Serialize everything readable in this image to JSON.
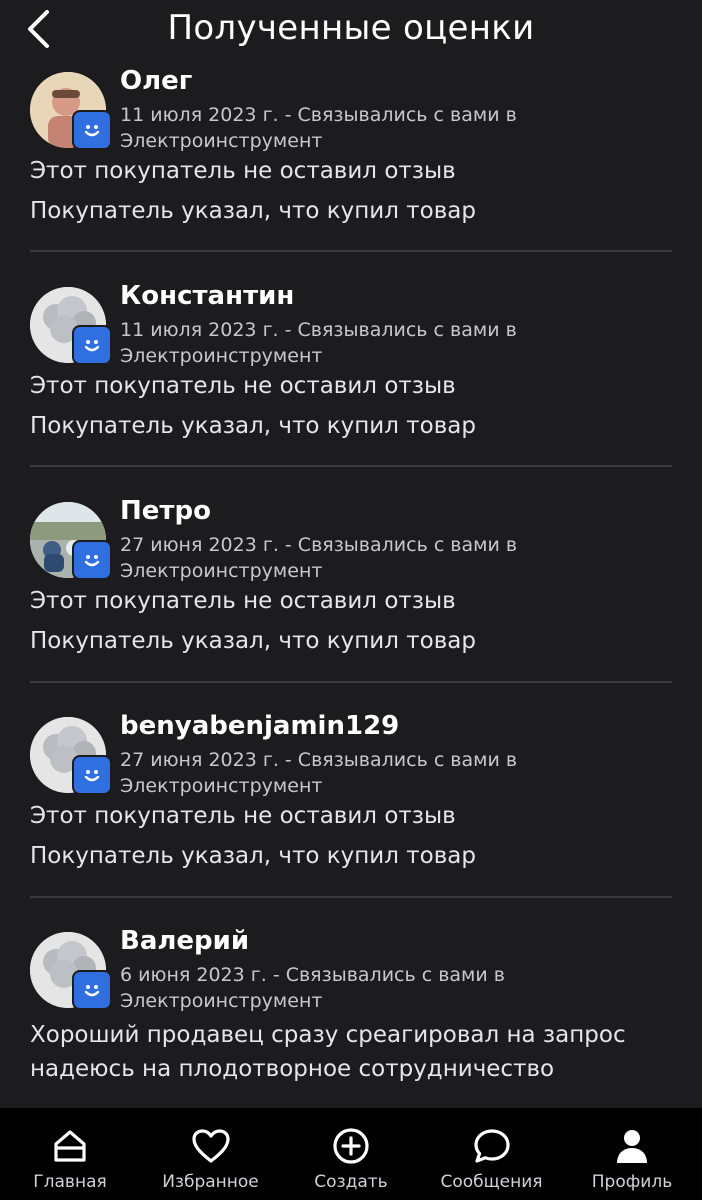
{
  "header": {
    "title": "Полученные оценки"
  },
  "reviews": [
    {
      "name": "Олег",
      "meta": "11 июля 2023 г. - Связывались с вами в Электроинструмент",
      "line1": "Этот покупатель не оставил отзыв",
      "line2": "Покупатель указал, что купил товар"
    },
    {
      "name": "Константин",
      "meta": "11 июля 2023 г. - Связывались с вами в Электроинструмент",
      "line1": "Этот покупатель не оставил отзыв",
      "line2": "Покупатель указал, что купил товар"
    },
    {
      "name": "Петро",
      "meta": "27 июня 2023 г. - Связывались с вами в Электроинструмент",
      "line1": "Этот покупатель не оставил отзыв",
      "line2": "Покупатель указал, что купил товар"
    },
    {
      "name": "benyabenjamin129",
      "meta": "27 июня 2023 г. - Связывались с вами в Электроинструмент",
      "line1": "Этот покупатель не оставил отзыв",
      "line2": "Покупатель указал, что купил товар"
    },
    {
      "name": "Валерий",
      "meta": "6 июня 2023 г. - Связывались с вами в Электроинструмент",
      "comment": "Хороший продавец сразу среагировал на запрос надеюсь на плодотворное сотрудничество"
    }
  ],
  "nav": [
    {
      "label": "Главная",
      "icon": "home-icon"
    },
    {
      "label": "Избранное",
      "icon": "heart-icon"
    },
    {
      "label": "Создать",
      "icon": "plus-circle-icon"
    },
    {
      "label": "Сообщения",
      "icon": "chat-bubble-icon"
    },
    {
      "label": "Профиль",
      "icon": "profile-icon"
    }
  ],
  "colors": {
    "background": "#1c1c1e",
    "badge": "#2f6fe0",
    "nav_background": "#000000"
  }
}
